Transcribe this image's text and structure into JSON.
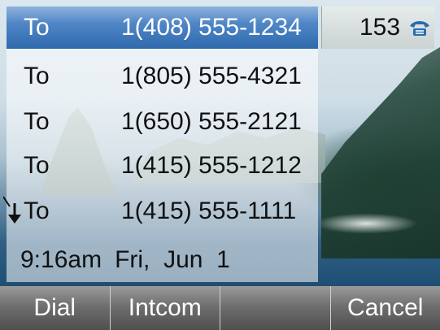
{
  "status": {
    "extension": "153",
    "line_icon": "desk-phone-icon",
    "line_icon_color": "#2a6bb0"
  },
  "call_list": {
    "selected_index": 0,
    "selected_color": "#2f6aad",
    "items": [
      {
        "direction": "To",
        "number": "1(408) 555-1234"
      },
      {
        "direction": "To",
        "number": "1(805) 555-4321"
      },
      {
        "direction": "To",
        "number": "1(650) 555-2121"
      },
      {
        "direction": "To",
        "number": "1(415) 555-1212"
      },
      {
        "direction": "To",
        "number": "1(415) 555-1111"
      }
    ],
    "scroll_indicator_icon": "down-arrow-icon"
  },
  "clock": {
    "time": "9:16am",
    "date": "Fri,  Jun  1"
  },
  "softkeys": {
    "dial": "Dial",
    "intercom": "Intcom",
    "blank": "",
    "cancel": "Cancel"
  }
}
